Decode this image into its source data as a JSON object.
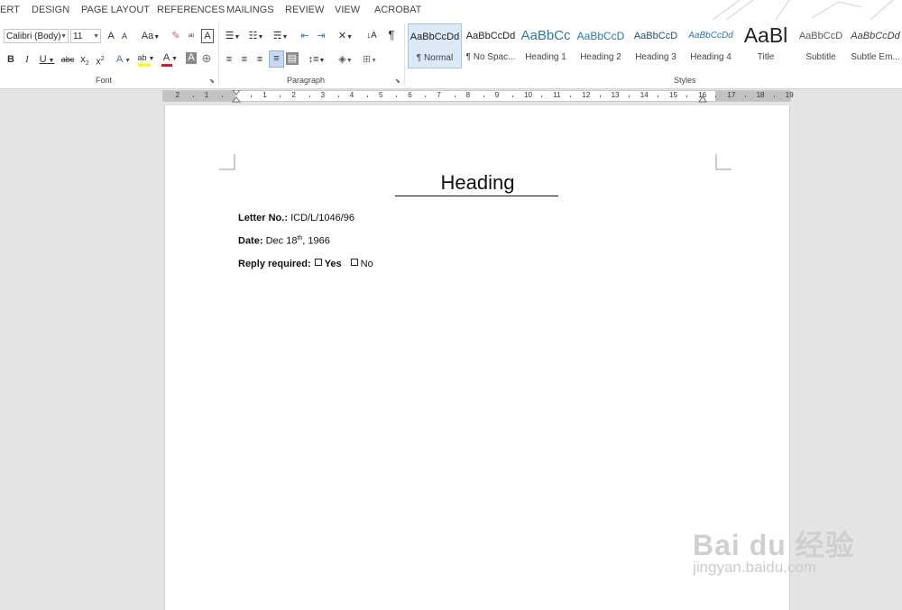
{
  "tabs": [
    "ERT",
    "DESIGN",
    "PAGE LAYOUT",
    "REFERENCES",
    "MAILINGS",
    "REVIEW",
    "VIEW",
    "ACROBAT"
  ],
  "font": {
    "name": "Calibri (Body)",
    "size": "11",
    "group_label": "Font",
    "buttons": {
      "grow": "A",
      "shrink": "A",
      "case": "Aa",
      "bold": "B",
      "italic": "I",
      "underline": "U",
      "strike": "abc",
      "subscript": "x",
      "superscript": "x",
      "subscript_digit": "2",
      "superscript_digit": "2",
      "effects": "A",
      "highlight": "ab",
      "color": "A",
      "shading": "A",
      "enclose": "A"
    }
  },
  "paragraph": {
    "group_label": "Paragraph",
    "pilcrow": "¶"
  },
  "styles": {
    "group_label": "Styles",
    "items": [
      {
        "sample": "AaBbCcDd",
        "name": "¶ Normal"
      },
      {
        "sample": "AaBbCcDd",
        "name": "¶ No Spac..."
      },
      {
        "sample": "AaBbCc",
        "name": "Heading 1"
      },
      {
        "sample": "AaBbCcD",
        "name": "Heading 2"
      },
      {
        "sample": "AaBbCcD",
        "name": "Heading 3"
      },
      {
        "sample": "AaBbCcDd",
        "name": "Heading 4"
      },
      {
        "sample": "AaBl",
        "name": "Title"
      },
      {
        "sample": "AaBbCcD",
        "name": "Subtitle"
      },
      {
        "sample": "AaBbCcDd",
        "name": "Subtle Em..."
      }
    ]
  },
  "ruler": {
    "labels": [
      "2",
      "1",
      "1",
      "2",
      "3",
      "4",
      "5",
      "6",
      "7",
      "8",
      "9",
      "10",
      "11",
      "12",
      "13",
      "14",
      "15",
      "16",
      "17",
      "18",
      "19"
    ]
  },
  "document": {
    "heading": "Heading",
    "letter_label": "Letter No.:",
    "letter_value": "ICD/L/1046/96",
    "date_label": "Date:",
    "date_value_pre": "Dec 18",
    "date_sup": "th",
    "date_value_post": ", 1966",
    "reply_label": "Reply required:",
    "reply_yes": "Yes",
    "reply_no": "No"
  },
  "watermark": {
    "logo": "Bai du 经验",
    "url": "jingyan.baidu.com"
  },
  "colors": {
    "accent": "#2b579a",
    "highlight": "#ffff00",
    "font_color": "#e81123"
  }
}
